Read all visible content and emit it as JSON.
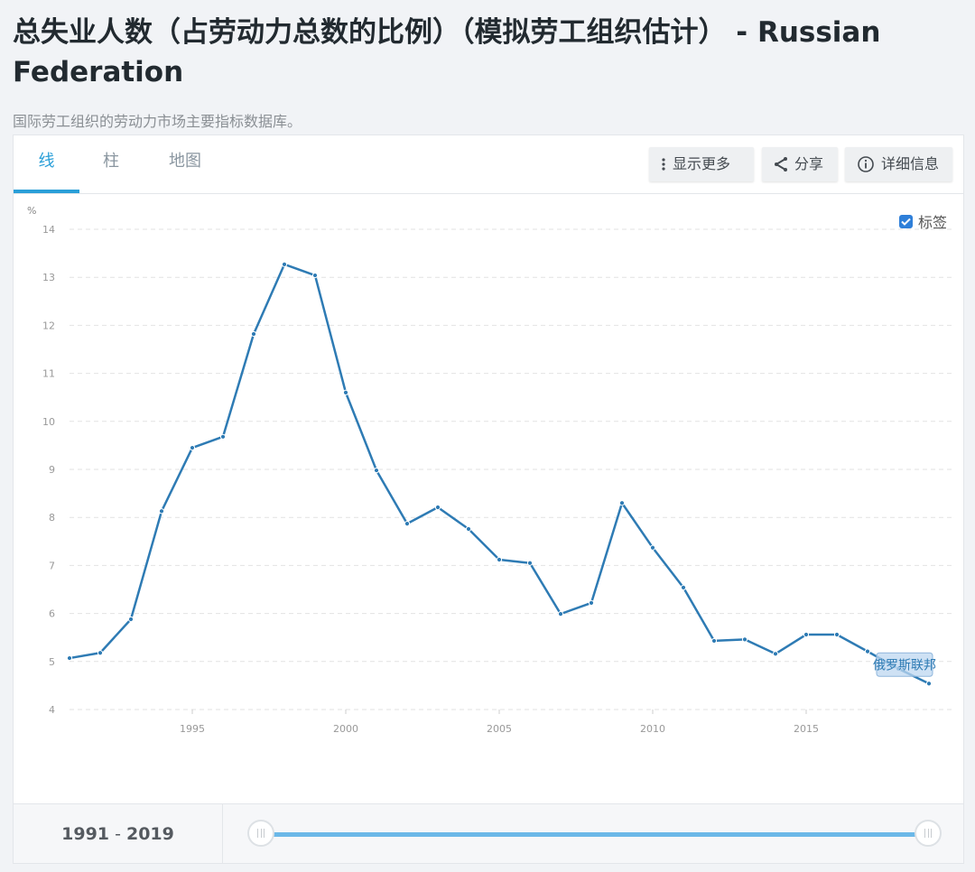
{
  "page": {
    "title": "总失业人数（占劳动力总数的比例）（模拟劳工组织估计） - Russian Federation",
    "subtitle": "国际劳工组织的劳动力市场主要指标数据库。"
  },
  "tabs": [
    {
      "label": "线",
      "active": true
    },
    {
      "label": "柱",
      "active": false
    },
    {
      "label": "地图",
      "active": false
    }
  ],
  "toolbar": {
    "more_label": "显示更多",
    "share_label": "分享",
    "info_label": "详细信息"
  },
  "legend_toggle": {
    "label": "标签",
    "checked": true
  },
  "footer": {
    "range_start": "1991",
    "range_sep": " - ",
    "range_end": "2019"
  },
  "colors": {
    "line": "#2e7bb4",
    "accent": "#2a9fd8",
    "slider": "#6bb8e8",
    "checkbox": "#2e7fd9"
  },
  "chart_data": {
    "type": "line",
    "title": "",
    "xlabel": "",
    "ylabel": "%",
    "ylim": [
      4,
      14
    ],
    "xlim": [
      1991,
      2019
    ],
    "yticks": [
      4,
      5,
      6,
      7,
      8,
      9,
      10,
      11,
      12,
      13,
      14
    ],
    "xticks": [
      1995,
      2000,
      2005,
      2010,
      2015
    ],
    "grid": true,
    "x": [
      1991,
      1992,
      1993,
      1994,
      1995,
      1996,
      1997,
      1998,
      1999,
      2000,
      2001,
      2002,
      2003,
      2004,
      2005,
      2006,
      2007,
      2008,
      2009,
      2010,
      2011,
      2012,
      2013,
      2014,
      2015,
      2016,
      2017,
      2018,
      2019
    ],
    "series": [
      {
        "name": "俄罗斯联邦",
        "values": [
          5.07,
          5.18,
          5.88,
          8.13,
          9.45,
          9.68,
          11.82,
          13.27,
          13.04,
          10.6,
          8.98,
          7.87,
          8.21,
          7.76,
          7.12,
          7.05,
          5.99,
          6.22,
          8.3,
          7.37,
          6.54,
          5.43,
          5.46,
          5.16,
          5.56,
          5.56,
          5.21,
          4.85,
          4.54
        ]
      }
    ],
    "series_label_position": "end-of-line"
  }
}
